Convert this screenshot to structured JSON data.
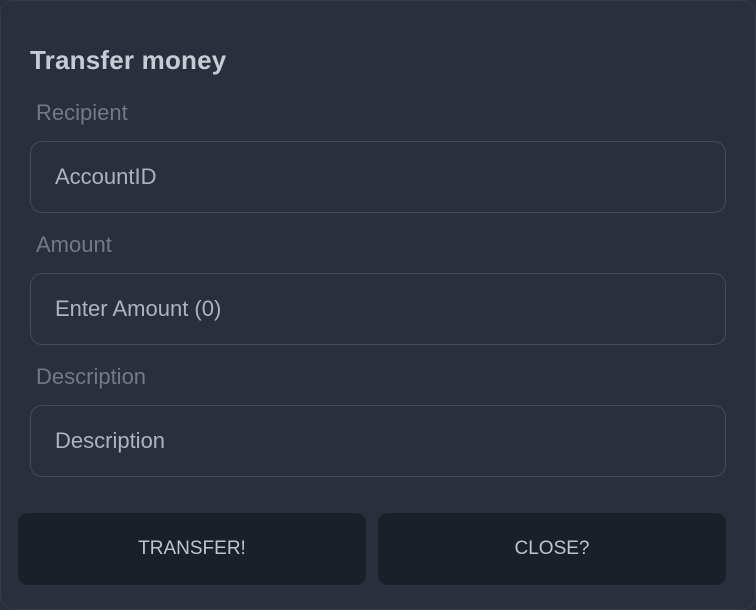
{
  "dialog": {
    "title": "Transfer money"
  },
  "form": {
    "recipient": {
      "label": "Recipient",
      "placeholder": "AccountID",
      "value": ""
    },
    "amount": {
      "label": "Amount",
      "placeholder": "Enter Amount (0)",
      "value": ""
    },
    "description": {
      "label": "Description",
      "placeholder": "Description",
      "value": ""
    }
  },
  "actions": {
    "transfer_label": "TRANSFER!",
    "close_label": "CLOSE?"
  },
  "colors": {
    "background": "#2a2f3b",
    "button_background": "#1b1f27",
    "field_border": "#444a56",
    "label_text": "#737987",
    "title_text": "#c7cbd6"
  }
}
